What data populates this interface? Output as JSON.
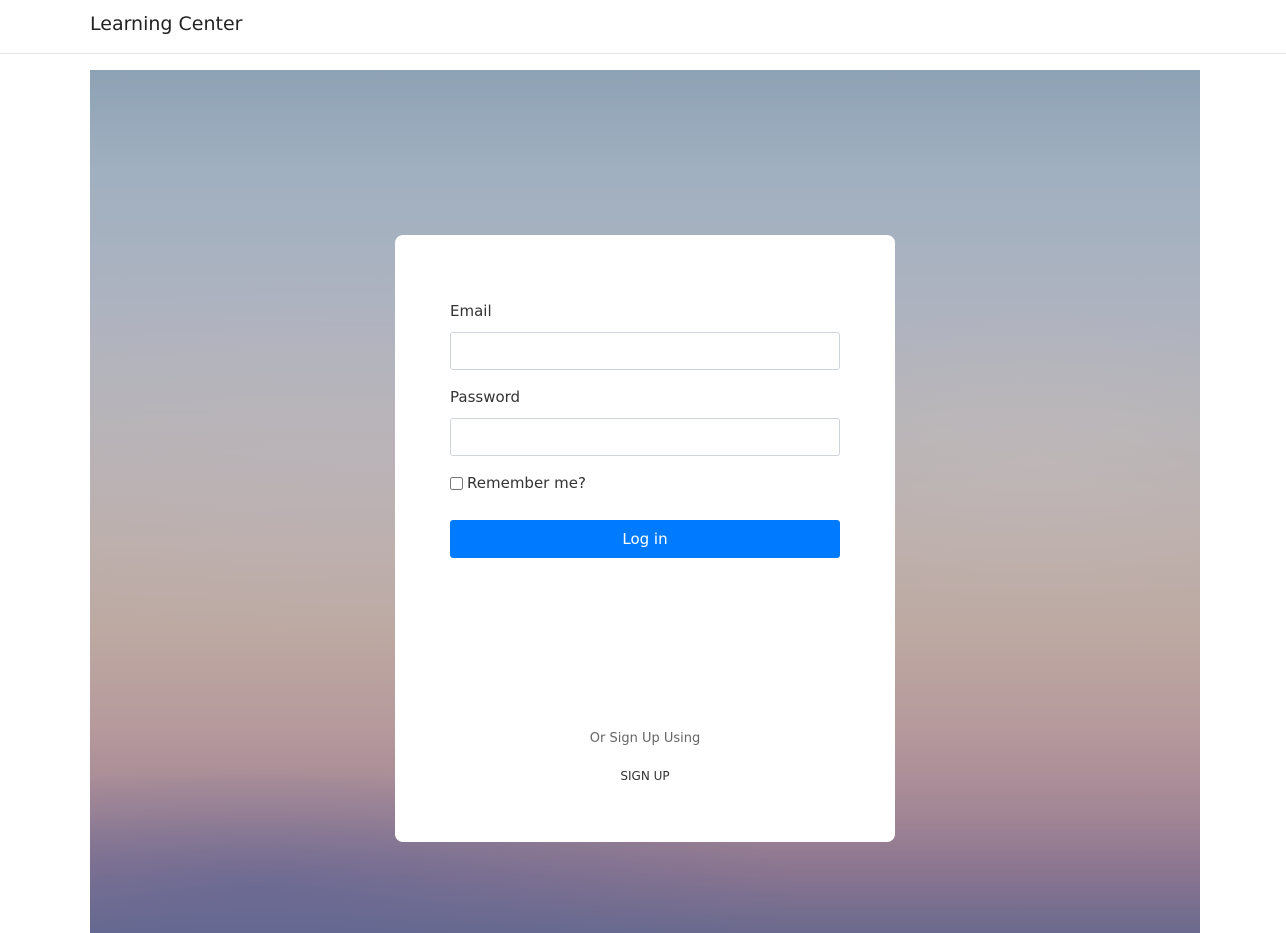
{
  "navbar": {
    "brand": "Learning Center"
  },
  "login_form": {
    "email_label": "Email",
    "email_value": "",
    "password_label": "Password",
    "password_value": "",
    "remember_label": "Remember me?",
    "remember_checked": false,
    "submit_label": "Log in",
    "alt_text": "Or Sign Up Using",
    "signup_label": "SIGN UP"
  },
  "colors": {
    "primary_button": "#007bff",
    "card_background": "#ffffff"
  }
}
